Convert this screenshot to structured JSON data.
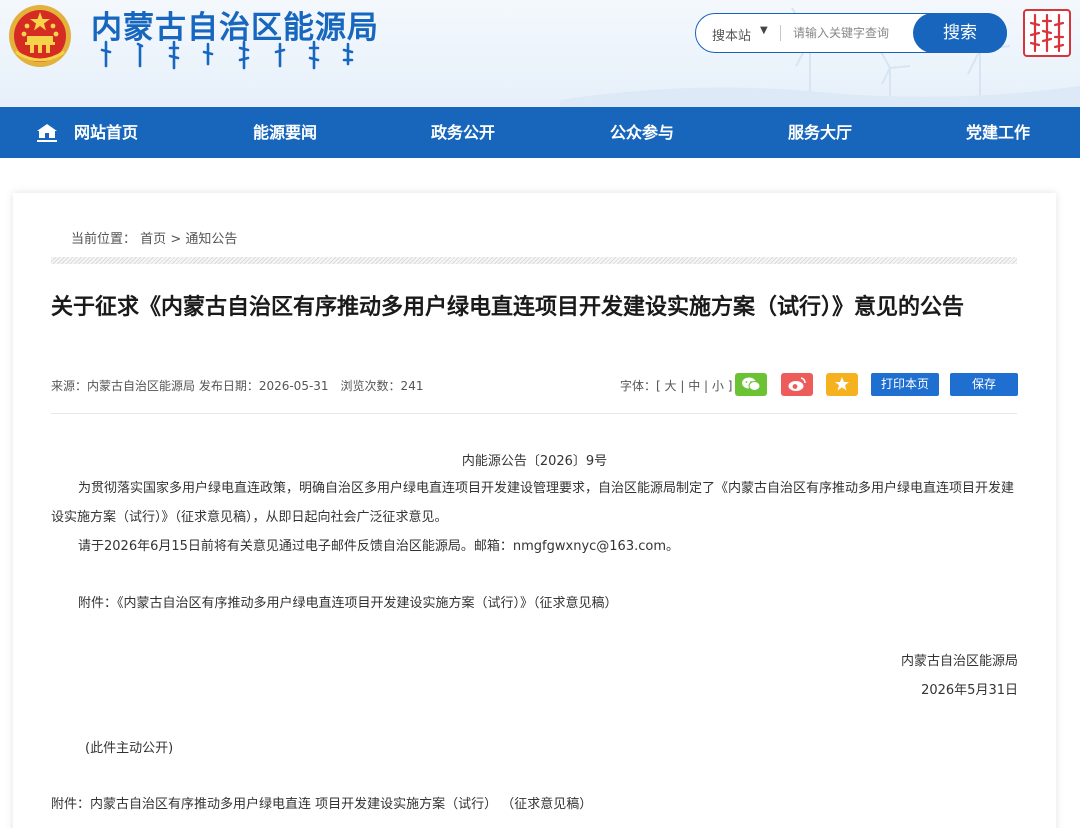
{
  "header": {
    "site_title": "内蒙古自治区能源局",
    "search": {
      "scope": "搜本站",
      "placeholder": "请输入关键字查询",
      "button": "搜索"
    }
  },
  "nav": {
    "items": [
      {
        "label": "网站首页"
      },
      {
        "label": "能源要闻"
      },
      {
        "label": "政务公开"
      },
      {
        "label": "公众参与"
      },
      {
        "label": "服务大厅"
      },
      {
        "label": "党建工作"
      }
    ]
  },
  "breadcrumb": {
    "prefix": "当前位置：",
    "home": "首页",
    "sep": ">",
    "current": "通知公告"
  },
  "article": {
    "title": "关于征求《内蒙古自治区有序推动多用户绿电直连项目开发建设实施方案（试行）》意见的公告",
    "meta": "来源：内蒙古自治区能源局 发布日期：2026-05-31　浏览次数：241",
    "font_label": "字体：",
    "font_large": "大",
    "font_mid": "中",
    "font_small": "小",
    "print_btn": "打印本页",
    "save_btn": "保存",
    "doc_no": "内能源公告〔2026〕9号",
    "para1": "为贯彻落实国家多用户绿电直连政策，明确自治区多用户绿电直连项目开发建设管理要求，自治区能源局制定了《内蒙古自治区有序推动多用户绿电直连项目开发建设实施方案（试行）》（征求意见稿），从即日起向社会广泛征求意见。",
    "para2": "请于2026年6月15日前将有关意见通过电子邮件反馈自治区能源局。邮箱：nmgfgwxnyc@163.com。",
    "para3": "附件：《内蒙古自治区有序推动多用户绿电直连项目开发建设实施方案（试行）》（征求意见稿）",
    "signature_org": "内蒙古自治区能源局",
    "signature_date": "2026年5月31日",
    "public_note": "(此件主动公开)",
    "attachment_link": "附件：内蒙古自治区有序推动多用户绿电直连 项目开发建设实施方案（试行）  （征求意见稿）"
  },
  "colors": {
    "brand_blue": "#1766bc",
    "wechat_green": "#6bc235",
    "weibo_red": "#ee5b5b",
    "favorite_yellow": "#f5b21e"
  }
}
